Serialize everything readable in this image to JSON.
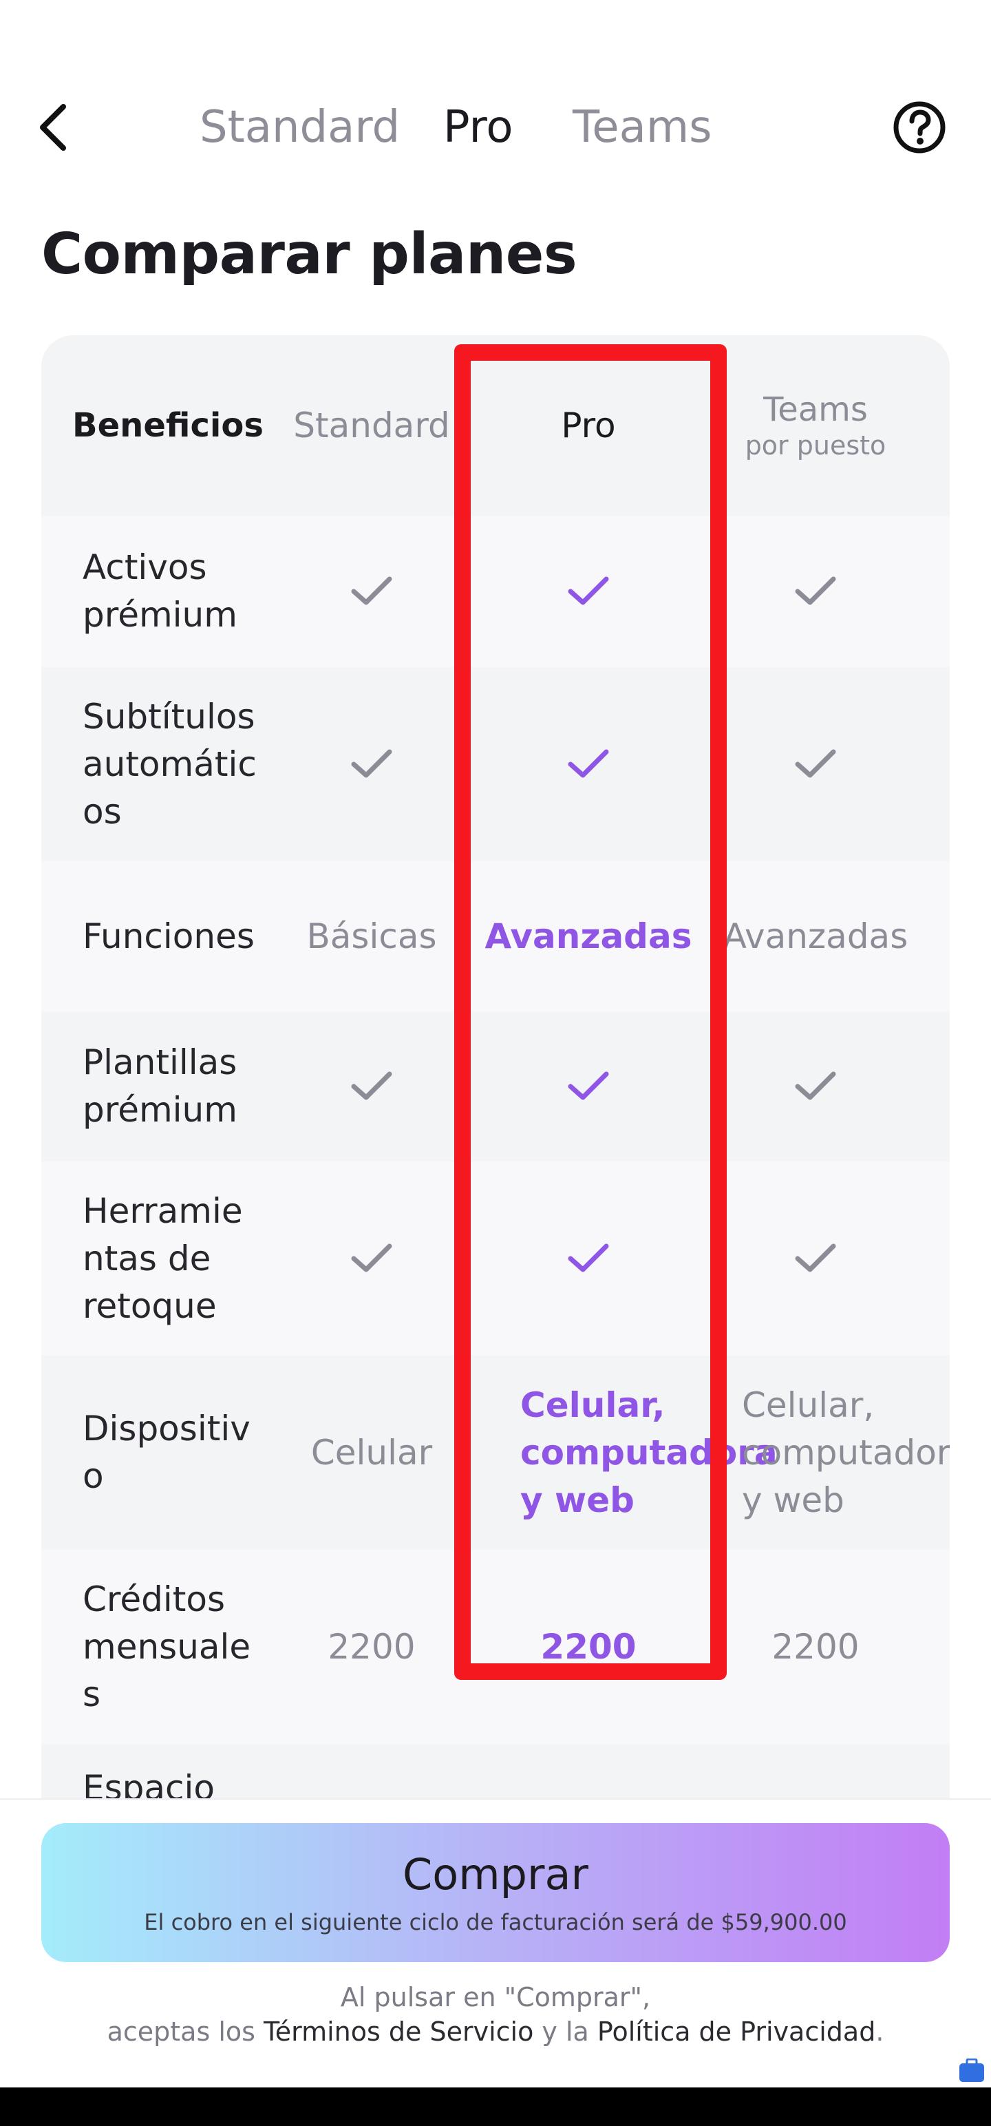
{
  "header": {
    "tabs": [
      {
        "label": "Standard",
        "active": false
      },
      {
        "label": "Pro",
        "active": true
      },
      {
        "label": "Teams",
        "active": false
      }
    ],
    "back_icon": "chevron-left-icon",
    "help_icon": "question-circle-icon"
  },
  "title": "Comparar planes",
  "table": {
    "header": {
      "label": "Beneficios",
      "standard": "Standard",
      "pro": "Pro",
      "teams": "Teams",
      "teams_sub": "por puesto"
    },
    "rows": [
      {
        "label": "Activos prémium",
        "standard": "check",
        "pro": "check",
        "teams": "check"
      },
      {
        "label": "Subtítulos automáticos",
        "label_lines": [
          "Subtítulos",
          "automátic",
          "os"
        ],
        "standard": "check",
        "pro": "check",
        "teams": "check"
      },
      {
        "label": "Funciones",
        "standard": "Básicas",
        "pro": "Avanzadas",
        "teams": "Avanzadas"
      },
      {
        "label": "Plantillas prémium",
        "label_lines": [
          "Plantillas",
          "prémium"
        ],
        "standard": "check",
        "pro": "check",
        "teams": "check"
      },
      {
        "label": "Herramientas de retoque",
        "label_lines": [
          "Herramie",
          "ntas de",
          "retoque"
        ],
        "standard": "check",
        "pro": "check",
        "teams": "check"
      },
      {
        "label": "Dispositivo",
        "label_lines": [
          "Dispositiv",
          "o"
        ],
        "standard": "Celular",
        "pro_lines": [
          "Celular,",
          "computadora",
          "y web"
        ],
        "teams_lines": [
          "Celular,",
          "computadora",
          "y web"
        ]
      },
      {
        "label": "Créditos mensuales",
        "label_lines": [
          "Créditos",
          "mensuale",
          "s"
        ],
        "standard": "2200",
        "pro": "2200",
        "teams": "2200"
      },
      {
        "label": "Espacio"
      }
    ]
  },
  "buy": {
    "label": "Comprar",
    "sub": "El cobro en el siguiente ciclo de facturación será de $59,900.00"
  },
  "legal": {
    "line1": "Al pulsar en \"Comprar\",",
    "prefix": "aceptas los ",
    "terms": "Términos de Servicio",
    "middle": " y la ",
    "privacy": "Política de Privacidad",
    "suffix": "."
  },
  "colors": {
    "accent": "#8f55e4",
    "highlight": "#f5191f",
    "check_gray": "#8b8c96"
  }
}
